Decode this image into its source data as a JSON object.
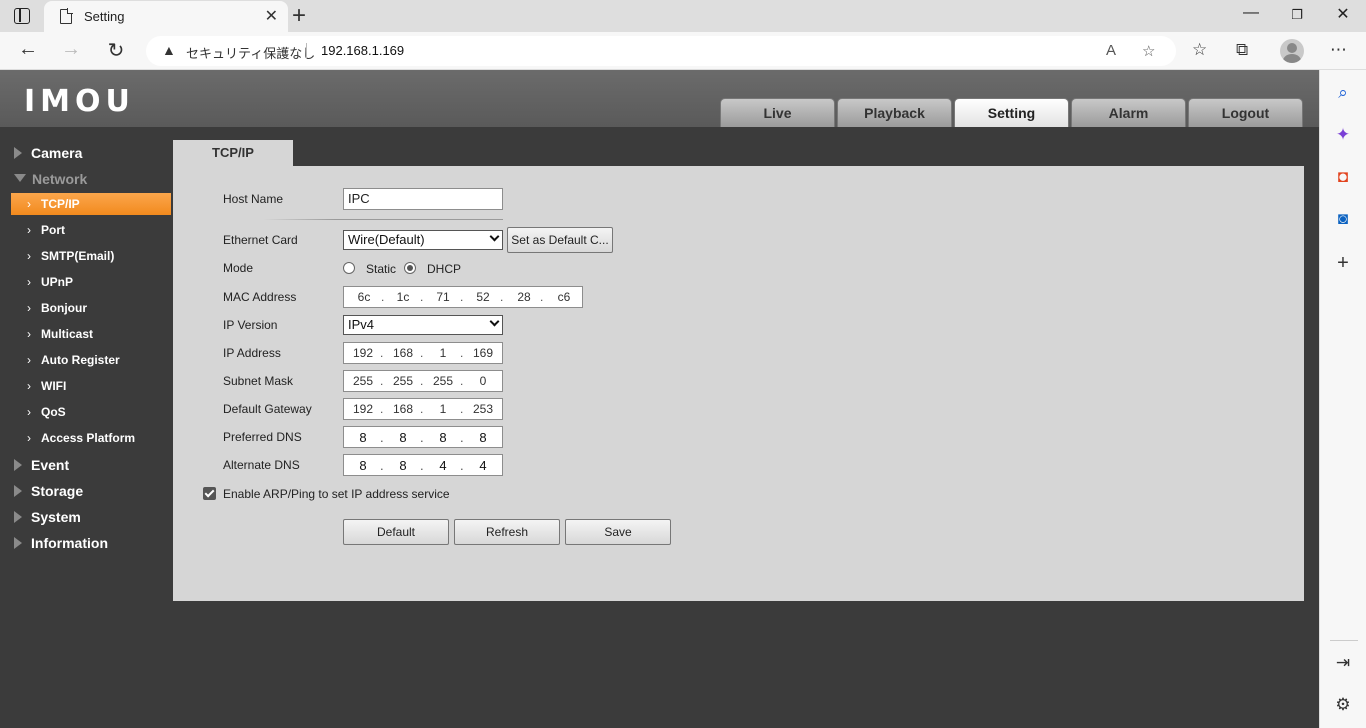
{
  "browser": {
    "tab_title": "Setting",
    "security_text": "セキュリティ保護なし",
    "url": "192.168.1.169"
  },
  "app": {
    "logo": "IMOU",
    "top_tabs": [
      "Live",
      "Playback",
      "Setting",
      "Alarm",
      "Logout"
    ],
    "active_top_tab": "Setting",
    "nav": {
      "camera": "Camera",
      "network": "Network",
      "network_items": [
        "TCP/IP",
        "Port",
        "SMTP(Email)",
        "UPnP",
        "Bonjour",
        "Multicast",
        "Auto Register",
        "WIFI",
        "QoS",
        "Access Platform"
      ],
      "event": "Event",
      "storage": "Storage",
      "system": "System",
      "information": "Information"
    },
    "content_tab": "TCP/IP",
    "form": {
      "host_name_label": "Host Name",
      "host_name_value": "IPC",
      "ethernet_card_label": "Ethernet Card",
      "ethernet_card_value": "Wire(Default)",
      "set_default_button": "Set as Default C...",
      "mode_label": "Mode",
      "mode_static": "Static",
      "mode_dhcp": "DHCP",
      "mode_selected": "DHCP",
      "mac_label": "MAC Address",
      "mac": [
        "6c",
        "1c",
        "71",
        "52",
        "28",
        "c6"
      ],
      "ip_version_label": "IP Version",
      "ip_version_value": "IPv4",
      "ip_address_label": "IP Address",
      "ip_address": [
        "192",
        "168",
        "1",
        "169"
      ],
      "subnet_label": "Subnet Mask",
      "subnet": [
        "255",
        "255",
        "255",
        "0"
      ],
      "gateway_label": "Default Gateway",
      "gateway": [
        "192",
        "168",
        "1",
        "253"
      ],
      "pref_dns_label": "Preferred DNS",
      "pref_dns": [
        "8",
        "8",
        "8",
        "8"
      ],
      "alt_dns_label": "Alternate DNS",
      "alt_dns": [
        "8",
        "8",
        "4",
        "4"
      ],
      "arp_label": "Enable ARP/Ping to set IP address service",
      "arp_checked": true,
      "default_button": "Default",
      "refresh_button": "Refresh",
      "save_button": "Save"
    }
  }
}
